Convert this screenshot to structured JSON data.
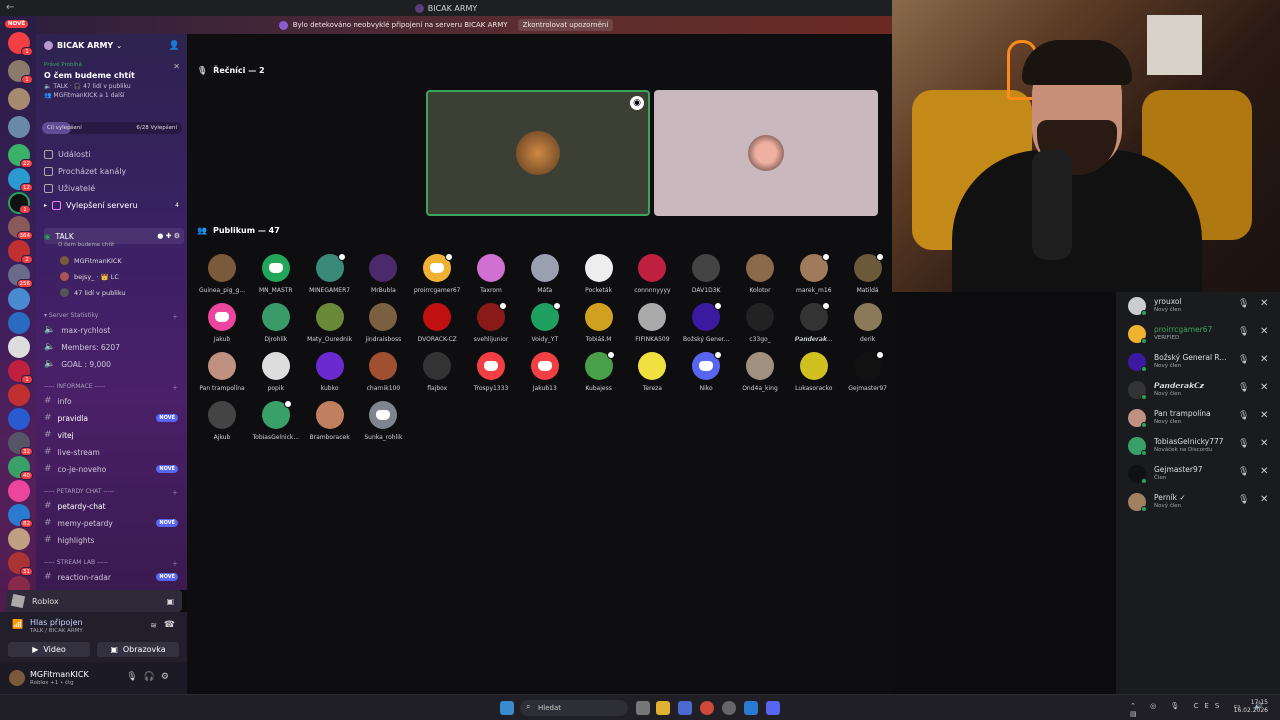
{
  "window": {
    "title": "BICAK ARMY",
    "back_glyph": "←"
  },
  "banner": {
    "text": "Bylo detekováno neobvyklé připojení na serveru BICAK ARMY",
    "button": "Zkontrolovat upozornění"
  },
  "rail": {
    "new_label": "NOVÉ",
    "badges": [
      "1",
      "1",
      "22",
      "12",
      "1",
      "364",
      "2",
      "256",
      "1",
      "32",
      "40",
      "82",
      "31"
    ]
  },
  "server": {
    "name": "BICAK ARMY",
    "event": {
      "status": "Právě Probíhá",
      "title": "O čem budeme chtít",
      "channel": "TALK",
      "audience": "47 lidí v publiku",
      "hosts": "MGFitmanKICK a 1 další"
    },
    "boost": {
      "goal": "Cíl vylepšení",
      "progress": "6/28 Vylepšení",
      "fraction": 0.21
    }
  },
  "nav": {
    "events": "Události",
    "browse": "Procházet kanály",
    "members": "Uživatelé",
    "boosts": "Vylepšení serveru",
    "boosts_count": "4"
  },
  "voice_channel": {
    "name": "TALK",
    "topic": "O čem budeme chtít",
    "users": [
      {
        "name": "MGFitmanKICK",
        "color": "#7a5a3a"
      },
      {
        "name": "bejsy_ · 👑 LC",
        "color": "#aa5555"
      },
      {
        "name": "47 lidí v publiku",
        "color": "#555"
      }
    ]
  },
  "categories": [
    {
      "name": "Server Statistiky",
      "items": [
        "max-rychlost",
        "Members: 6207",
        "GOAL : 9,000"
      ]
    },
    {
      "name": "----- INFORMACE -----",
      "items": [
        "info",
        "pravidla",
        "vitej",
        "live-stream",
        "co-je-noveho"
      ]
    },
    {
      "name": "----- PETARDY CHAT -----",
      "items": [
        "petardy-chat",
        "memy-petardy",
        "highlights"
      ]
    },
    {
      "name": "----- STREAM LAB -----",
      "items": [
        "reaction-radar"
      ]
    }
  ],
  "new_badge": "NOVÉ",
  "activity": {
    "name": "Roblox"
  },
  "voice_status": {
    "status": "Hlas připojen",
    "location": "TALK / BICAK ARMY",
    "video": "Video",
    "screen": "Obrazovka"
  },
  "user": {
    "name": "MGFitmanKICK",
    "activity": "Roblox +1 • čtg"
  },
  "stage": {
    "speakers_header": "Řečníci — 2",
    "audience_header": "Publikum — 47",
    "audience": [
      {
        "name": "Guinea_pig_g...",
        "color": "#7a5a3a"
      },
      {
        "name": "MN_MASTR",
        "color": "#23a55a",
        "discord": true
      },
      {
        "name": "MINEGAMER7",
        "color": "#3a8a7a",
        "dot": true
      },
      {
        "name": "MrBubla",
        "color": "#4a2a6a"
      },
      {
        "name": "proirrcgamer67",
        "color": "#f0b232",
        "discord": true,
        "dot": true
      },
      {
        "name": "Taxrom",
        "color": "#d070d0"
      },
      {
        "name": "Máťa",
        "color": "#9aa0b0"
      },
      {
        "name": "Pocketák",
        "color": "#eee"
      },
      {
        "name": "connnnyyyy",
        "color": "#c02040"
      },
      {
        "name": "DAV1D3K",
        "color": "#444"
      },
      {
        "name": "Kolotor",
        "color": "#8a6a4a"
      },
      {
        "name": "marek_m16",
        "color": "#a07a5a",
        "dot": true
      },
      {
        "name": "Matildá",
        "color": "#6a5a3a",
        "dot": true
      },
      {
        "name": "Jakub",
        "color": "#eb459e",
        "discord": true
      },
      {
        "name": "Djrohlik",
        "color": "#3a9a6a"
      },
      {
        "name": "Maty_Ourednik",
        "color": "#6a8a3a"
      },
      {
        "name": "jindraisboss",
        "color": "#7a6040"
      },
      {
        "name": "DVORACK-CZ",
        "color": "#c01010"
      },
      {
        "name": "svehlijunior",
        "color": "#8a1a1a",
        "dot": true
      },
      {
        "name": "Voidy_YT",
        "color": "#20a060",
        "dot": true
      },
      {
        "name": "Tobiáš.M",
        "color": "#d0a020"
      },
      {
        "name": "FIFINKA509",
        "color": "#aaa"
      },
      {
        "name": "Božský Gener...",
        "color": "#3a1aa0",
        "dot": true
      },
      {
        "name": "c33go_",
        "color": "#222"
      },
      {
        "name": "𝙋𝙖𝙣𝙙𝙚𝙧𝙖𝙠...",
        "color": "#333",
        "dot": true
      },
      {
        "name": "derik",
        "color": "#8a7a5a"
      },
      {
        "name": "Pan trampolína",
        "color": "#c09080"
      },
      {
        "name": "popik",
        "color": "#ddd"
      },
      {
        "name": "kubko",
        "color": "#6a2ad0"
      },
      {
        "name": "charnik100",
        "color": "#a05030"
      },
      {
        "name": "flajbox",
        "color": "#333"
      },
      {
        "name": "Trospy1333",
        "color": "#f23f43",
        "discord": true
      },
      {
        "name": "Jakub13",
        "color": "#f23f43",
        "discord": true
      },
      {
        "name": "Kubajess",
        "color": "#4aa04a",
        "dot": true
      },
      {
        "name": "Tereza",
        "color": "#f0e040"
      },
      {
        "name": "Niko",
        "color": "#5865f2",
        "discord": true,
        "dot": true
      },
      {
        "name": "Ond4a_king",
        "color": "#a09080"
      },
      {
        "name": "Lukasoracko",
        "color": "#d0c020"
      },
      {
        "name": "Gejmaster97",
        "color": "#111",
        "dot": true
      },
      {
        "name": "Ajkub",
        "color": "#444"
      },
      {
        "name": "TobiasGelnick...",
        "color": "#3aa06a",
        "dot": true
      },
      {
        "name": "Bramboracek",
        "color": "#c08060"
      },
      {
        "name": "Sunka_rohlik",
        "color": "#80848e",
        "discord": true
      }
    ]
  },
  "members": [
    {
      "name": "yrouxol",
      "sub": "Nový člen",
      "color": "#ccc"
    },
    {
      "name": "proirrcgamer67",
      "sub": "VERIFIED",
      "color": "#f0b232",
      "green": true
    },
    {
      "name": "Božský General R...",
      "sub": "Nový člen",
      "color": "#3a1aa0"
    },
    {
      "name": "𝙋𝙖𝙣𝙙𝙚𝙧𝙖𝙠𝘾𝙯",
      "sub": "Nový člen",
      "color": "#333"
    },
    {
      "name": "Pan trampolína",
      "sub": "Nový člen",
      "color": "#c09080"
    },
    {
      "name": "TobiasGelnicky777",
      "sub": "Nováček na Discordu",
      "color": "#3aa06a"
    },
    {
      "name": "Gejmaster97",
      "sub": "Člen",
      "color": "#111"
    },
    {
      "name": "Perník ✓",
      "sub": "Nový člen",
      "color": "#a08060"
    }
  ],
  "taskbar": {
    "search": "Hledat",
    "lang": "CES",
    "time": "17:15",
    "date": "16.02.2026"
  }
}
